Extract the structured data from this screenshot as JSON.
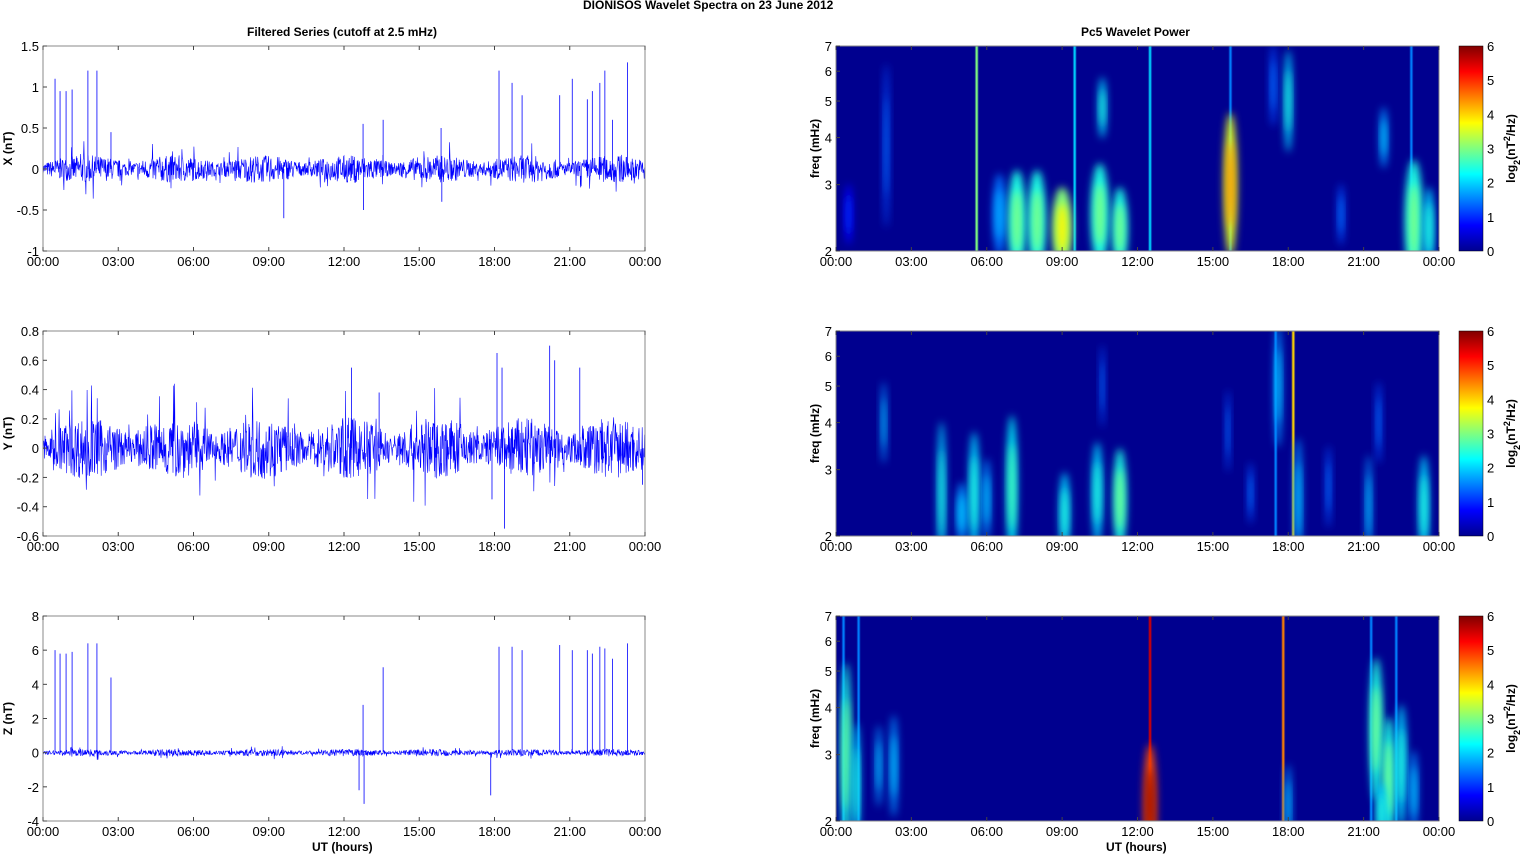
{
  "figure_title": "DIONISOS Wavelet Spectra on 23 June     2012",
  "chart_data": [
    {
      "type": "line",
      "title": "Filtered Series (cutoff at 2.5 mHz)",
      "ylabel": "X (nT)",
      "xlabel": "",
      "ylim": [
        -1,
        1.5
      ],
      "yticks": [
        "-1",
        "-0.5",
        "0",
        "0.5",
        "1",
        "1.5"
      ],
      "ytick_values": [
        -1,
        -0.5,
        0,
        0.5,
        1,
        1.5
      ],
      "xlim_hours": [
        0,
        24
      ],
      "xticks": [
        "00:00",
        "03:00",
        "06:00",
        "09:00",
        "12:00",
        "15:00",
        "18:00",
        "21:00",
        "00:00"
      ],
      "color": "#0000ff",
      "noise_amplitude": 0.12,
      "spikes": [
        [
          0.48,
          1.1
        ],
        [
          0.68,
          0.95
        ],
        [
          0.92,
          0.95
        ],
        [
          1.16,
          0.97
        ],
        [
          1.79,
          1.2
        ],
        [
          2.15,
          1.2
        ],
        [
          2.71,
          0.45
        ],
        [
          12.76,
          0.55
        ],
        [
          12.78,
          -0.5
        ],
        [
          13.56,
          0.6
        ],
        [
          15.87,
          0.5
        ],
        [
          15.9,
          -0.4
        ],
        [
          18.18,
          1.2
        ],
        [
          18.7,
          1.05
        ],
        [
          19.1,
          0.9
        ],
        [
          20.6,
          0.9
        ],
        [
          21.1,
          1.1
        ],
        [
          21.7,
          0.85
        ],
        [
          21.9,
          0.95
        ],
        [
          22.2,
          1.05
        ],
        [
          22.4,
          1.2
        ],
        [
          22.7,
          0.6
        ],
        [
          23.3,
          1.3
        ],
        [
          9.6,
          -0.6
        ]
      ]
    },
    {
      "type": "line",
      "title": "",
      "ylabel": "Y (nT)",
      "xlabel": "",
      "ylim": [
        -0.6,
        0.8
      ],
      "yticks": [
        "-0.6",
        "-0.4",
        "-0.2",
        "0",
        "0.2",
        "0.4",
        "0.6",
        "0.8"
      ],
      "ytick_values": [
        -0.6,
        -0.4,
        -0.2,
        0,
        0.2,
        0.4,
        0.6,
        0.8
      ],
      "xlim_hours": [
        0,
        24
      ],
      "xticks": [
        "00:00",
        "03:00",
        "06:00",
        "09:00",
        "12:00",
        "15:00",
        "18:00",
        "21:00",
        "00:00"
      ],
      "color": "#0000ff",
      "noise_amplitude": 0.15,
      "spikes": [
        [
          12.3,
          0.55
        ],
        [
          13.4,
          0.38
        ],
        [
          18.1,
          0.65
        ],
        [
          18.3,
          0.55
        ],
        [
          18.4,
          -0.55
        ],
        [
          17.9,
          -0.35
        ],
        [
          20.2,
          0.7
        ],
        [
          20.4,
          0.6
        ],
        [
          21.4,
          0.55
        ],
        [
          23.9,
          -0.25
        ]
      ]
    },
    {
      "type": "line",
      "title": "",
      "ylabel": "Z (nT)",
      "xlabel": "UT (hours)",
      "ylim": [
        -4,
        8
      ],
      "yticks": [
        "-4",
        "-2",
        "0",
        "2",
        "4",
        "6",
        "8"
      ],
      "ytick_values": [
        -4,
        -2,
        0,
        2,
        4,
        6,
        8
      ],
      "xlim_hours": [
        0,
        24
      ],
      "xticks": [
        "00:00",
        "03:00",
        "06:00",
        "09:00",
        "12:00",
        "15:00",
        "18:00",
        "21:00",
        "00:00"
      ],
      "color": "#0000ff",
      "noise_amplitude": 0.15,
      "spikes": [
        [
          0.48,
          6
        ],
        [
          0.68,
          5.8
        ],
        [
          0.92,
          5.8
        ],
        [
          1.16,
          5.9
        ],
        [
          1.79,
          6.4
        ],
        [
          2.15,
          6.4
        ],
        [
          2.71,
          4.4
        ],
        [
          12.76,
          2.8
        ],
        [
          12.8,
          -3
        ],
        [
          12.6,
          -2.2
        ],
        [
          13.56,
          5
        ],
        [
          17.85,
          -2.5
        ],
        [
          18.18,
          6.2
        ],
        [
          18.7,
          6.2
        ],
        [
          19.1,
          6
        ],
        [
          20.6,
          6.3
        ],
        [
          21.1,
          6
        ],
        [
          21.7,
          6
        ],
        [
          21.9,
          5.8
        ],
        [
          22.2,
          6.2
        ],
        [
          22.4,
          6.1
        ],
        [
          22.7,
          5.5
        ],
        [
          23.3,
          6.4
        ]
      ]
    },
    {
      "type": "heatmap",
      "title": "Pc5 Wavelet Power",
      "ylabel": "freq (mHz)",
      "xlabel": "",
      "yscale": "log",
      "ylim": [
        2,
        7
      ],
      "yticks": [
        "2",
        "3",
        "4",
        "5",
        "6",
        "7"
      ],
      "ytick_values": [
        2,
        3,
        4,
        5,
        6,
        7
      ],
      "xlim_hours": [
        0,
        24
      ],
      "xticks": [
        "00:00",
        "03:00",
        "06:00",
        "09:00",
        "12:00",
        "15:00",
        "18:00",
        "21:00",
        "00:00"
      ],
      "colorbar": {
        "label": "log2(nT2/Hz)",
        "range": [
          0,
          6
        ],
        "ticks": [
          "0",
          "1",
          "2",
          "3",
          "4",
          "5",
          "6"
        ],
        "colormap": "jet"
      },
      "blobs": [
        [
          0.5,
          2.5,
          0.15,
          0.15,
          1
        ],
        [
          2.0,
          3.8,
          0.1,
          0.4,
          1.5
        ],
        [
          6.5,
          2.5,
          0.25,
          0.2,
          1.8
        ],
        [
          7.2,
          2.4,
          0.35,
          0.25,
          3
        ],
        [
          8.0,
          2.4,
          0.35,
          0.25,
          3
        ],
        [
          9.0,
          2.3,
          0.4,
          0.2,
          3.8
        ],
        [
          10.5,
          2.5,
          0.35,
          0.25,
          3
        ],
        [
          10.6,
          4.8,
          0.15,
          0.15,
          2.5
        ],
        [
          11.3,
          2.3,
          0.3,
          0.2,
          3
        ],
        [
          15.7,
          3.0,
          0.25,
          0.35,
          4.5
        ],
        [
          17.4,
          5.5,
          0.12,
          0.2,
          1.5
        ],
        [
          18.0,
          5.0,
          0.15,
          0.25,
          2.5
        ],
        [
          20.1,
          2.5,
          0.12,
          0.15,
          1.5
        ],
        [
          21.8,
          4.0,
          0.15,
          0.15,
          2
        ],
        [
          23.0,
          2.4,
          0.35,
          0.3,
          3
        ],
        [
          23.6,
          2.3,
          0.2,
          0.2,
          2.5
        ]
      ],
      "lines": [
        [
          5.6,
          3
        ],
        [
          9.5,
          2
        ],
        [
          12.5,
          2
        ],
        [
          15.7,
          1.5
        ],
        [
          22.9,
          1.5
        ]
      ]
    },
    {
      "type": "heatmap",
      "title": "",
      "ylabel": "freq (mHz)",
      "xlabel": "",
      "yscale": "log",
      "ylim": [
        2,
        7
      ],
      "yticks": [
        "2",
        "3",
        "4",
        "5",
        "6",
        "7"
      ],
      "ytick_values": [
        2,
        3,
        4,
        5,
        6,
        7
      ],
      "xlim_hours": [
        0,
        24
      ],
      "xticks": [
        "00:00",
        "03:00",
        "06:00",
        "09:00",
        "12:00",
        "15:00",
        "18:00",
        "21:00",
        "00:00"
      ],
      "colorbar": {
        "label": "log2(nT2/Hz)",
        "range": [
          0,
          6
        ],
        "ticks": [
          "0",
          "1",
          "2",
          "3",
          "4",
          "5",
          "6"
        ],
        "colormap": "jet"
      },
      "blobs": [
        [
          1.9,
          4.0,
          0.1,
          0.2,
          2
        ],
        [
          4.2,
          2.6,
          0.15,
          0.35,
          2.5
        ],
        [
          5.0,
          2.3,
          0.2,
          0.15,
          2
        ],
        [
          5.5,
          2.6,
          0.2,
          0.3,
          2.5
        ],
        [
          6.0,
          2.5,
          0.15,
          0.2,
          2
        ],
        [
          7.0,
          2.7,
          0.2,
          0.35,
          2.8
        ],
        [
          9.1,
          2.3,
          0.2,
          0.2,
          2.5
        ],
        [
          10.4,
          2.6,
          0.2,
          0.25,
          2.5
        ],
        [
          10.6,
          5.0,
          0.08,
          0.2,
          1.5
        ],
        [
          11.3,
          2.5,
          0.25,
          0.25,
          3
        ],
        [
          15.6,
          3.8,
          0.08,
          0.2,
          1.5
        ],
        [
          16.5,
          2.6,
          0.1,
          0.15,
          1.5
        ],
        [
          17.6,
          5.0,
          0.15,
          0.3,
          2
        ],
        [
          18.4,
          2.5,
          0.15,
          0.3,
          2
        ],
        [
          19.6,
          2.7,
          0.1,
          0.2,
          1.5
        ],
        [
          21.2,
          2.4,
          0.12,
          0.25,
          2
        ],
        [
          21.6,
          4.0,
          0.1,
          0.2,
          1.5
        ],
        [
          23.4,
          2.4,
          0.2,
          0.25,
          2.5
        ]
      ],
      "lines": [
        [
          18.2,
          4
        ],
        [
          17.5,
          1.5
        ]
      ]
    },
    {
      "type": "heatmap",
      "title": "",
      "ylabel": "freq (mHz)",
      "xlabel": "UT (hours)",
      "yscale": "log",
      "ylim": [
        2,
        7
      ],
      "yticks": [
        "2",
        "3",
        "4",
        "5",
        "6",
        "7"
      ],
      "ytick_values": [
        2,
        3,
        4,
        5,
        6,
        7
      ],
      "xlim_hours": [
        0,
        24
      ],
      "xticks": [
        "00:00",
        "03:00",
        "06:00",
        "09:00",
        "12:00",
        "15:00",
        "18:00",
        "21:00",
        "00:00"
      ],
      "colorbar": {
        "label": "log2(nT2/Hz)",
        "range": [
          0,
          6
        ],
        "ticks": [
          "0",
          "1",
          "2",
          "3",
          "4",
          "5",
          "6"
        ],
        "colormap": "jet"
      },
      "blobs": [
        [
          0.4,
          3.0,
          0.2,
          0.45,
          3
        ],
        [
          0.8,
          2.5,
          0.15,
          0.3,
          2.5
        ],
        [
          1.7,
          2.8,
          0.12,
          0.2,
          2
        ],
        [
          2.3,
          2.8,
          0.15,
          0.25,
          2
        ],
        [
          12.5,
          2.2,
          0.25,
          0.3,
          6
        ],
        [
          18.0,
          2.2,
          0.12,
          0.2,
          2
        ],
        [
          21.5,
          3.5,
          0.25,
          0.35,
          3
        ],
        [
          22.0,
          2.6,
          0.25,
          0.3,
          3
        ],
        [
          22.5,
          2.8,
          0.2,
          0.3,
          2.5
        ],
        [
          23.0,
          2.4,
          0.15,
          0.2,
          2
        ],
        [
          21.7,
          2.1,
          0.2,
          0.15,
          2.5
        ]
      ],
      "lines": [
        [
          12.5,
          5.5
        ],
        [
          17.8,
          4.5
        ],
        [
          0.3,
          1.5
        ],
        [
          0.9,
          1.5
        ],
        [
          21.3,
          1.5
        ],
        [
          22.3,
          1.5
        ]
      ]
    }
  ]
}
